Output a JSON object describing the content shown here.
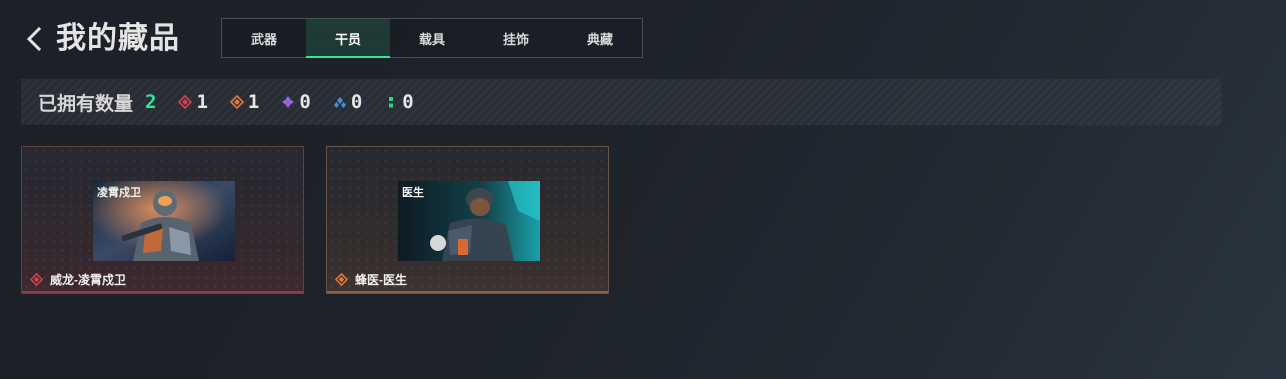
{
  "header": {
    "title": "我的藏品",
    "tabs": [
      {
        "label": "武器",
        "active": false
      },
      {
        "label": "干员",
        "active": true
      },
      {
        "label": "载具",
        "active": false
      },
      {
        "label": "挂饰",
        "active": false
      },
      {
        "label": "典藏",
        "active": false
      }
    ]
  },
  "summary": {
    "label": "已拥有数量",
    "total": "2",
    "rarities": [
      {
        "icon": "red-diamond-icon",
        "color": "#d9404a",
        "count": "1"
      },
      {
        "icon": "orange-diamond-icon",
        "color": "#e07a3a",
        "count": "1"
      },
      {
        "icon": "purple-diamond-icon",
        "color": "#9a63e0",
        "count": "0"
      },
      {
        "icon": "blue-diamond-icon",
        "color": "#4a8ed8",
        "count": "0"
      },
      {
        "icon": "green-dots-icon",
        "color": "#2fd27e",
        "count": "0"
      }
    ]
  },
  "items": [
    {
      "name": "威龙-凌霄戍卫",
      "image_label": "凌霄戍卫",
      "rarity": "red",
      "color": "#d9404a"
    },
    {
      "name": "蜂医-医生",
      "image_label": "医生",
      "rarity": "orange",
      "color": "#e07a3a"
    }
  ],
  "colors": {
    "accent": "#2fe59a",
    "red_rarity": "#d9404a",
    "orange_rarity": "#e07a3a"
  }
}
